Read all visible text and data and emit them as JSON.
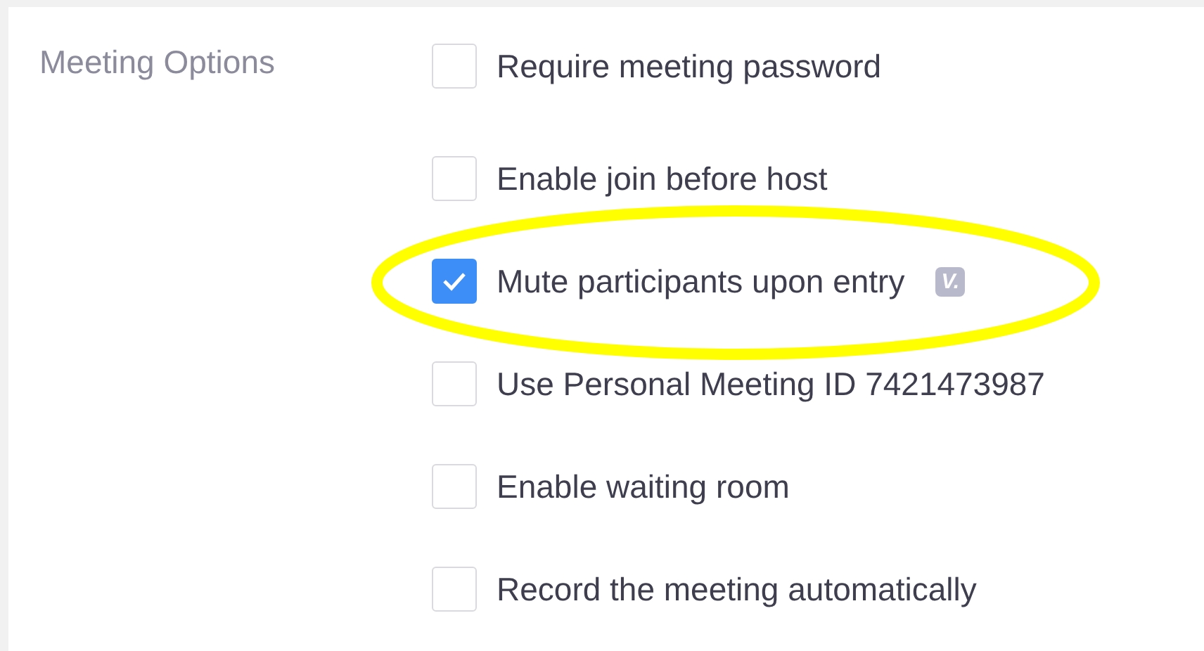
{
  "section_label": "Meeting Options",
  "options": [
    {
      "label": "Require meeting password",
      "checked": false,
      "highlighted": false
    },
    {
      "label": "Enable join before host",
      "checked": false,
      "highlighted": false
    },
    {
      "label": "Mute participants upon entry",
      "checked": true,
      "highlighted": true,
      "badge": "V."
    },
    {
      "label": "Use Personal Meeting ID 7421473987",
      "checked": false,
      "highlighted": false
    },
    {
      "label": "Enable waiting room",
      "checked": false,
      "highlighted": false
    },
    {
      "label": "Record the meeting automatically",
      "checked": false,
      "highlighted": false
    }
  ]
}
